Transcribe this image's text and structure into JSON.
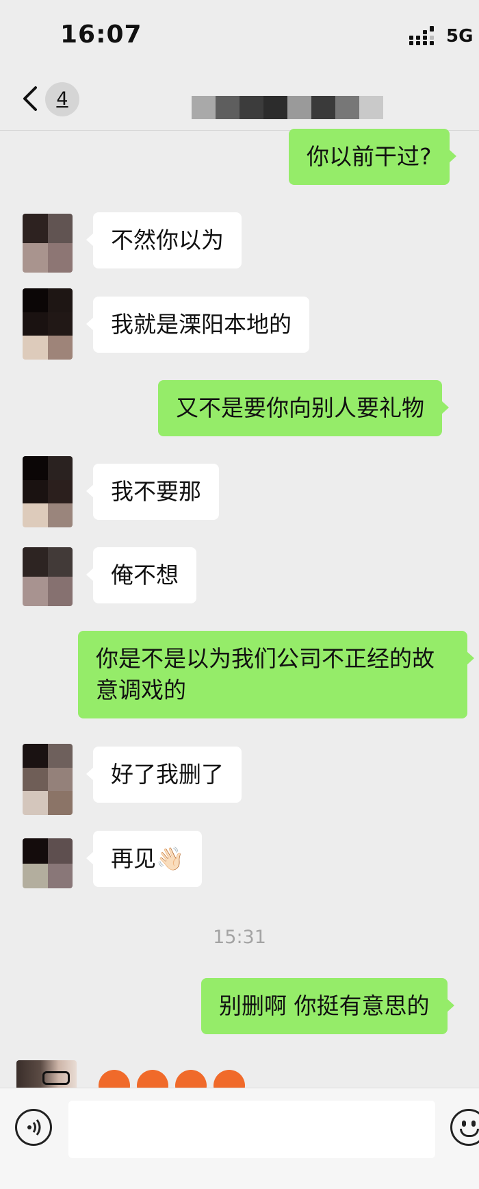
{
  "status": {
    "time": "16:07",
    "network": "5G"
  },
  "nav": {
    "unread_count": "4"
  },
  "messages": [
    {
      "side": "out",
      "text": "你以前干过?"
    },
    {
      "side": "in",
      "text": "不然你以为"
    },
    {
      "side": "in",
      "text": "我就是溧阳本地的"
    },
    {
      "side": "out",
      "text": "又不是要你向别人要礼物"
    },
    {
      "side": "in",
      "text": "我不要那"
    },
    {
      "side": "in",
      "text": "俺不想"
    },
    {
      "side": "out",
      "text": "你是不是以为我们公司不正经的故意调戏的"
    },
    {
      "side": "in",
      "text": "好了我删了"
    },
    {
      "side": "in",
      "text": "再见👋🏻"
    },
    {
      "side": "out",
      "text": "别删啊 你挺有意思的"
    }
  ],
  "timestamp": "15:31",
  "colors": {
    "background": "#ededed",
    "outgoing_bubble": "#95ec69",
    "incoming_bubble": "#ffffff"
  },
  "input_bar": {
    "left_icon": "voice-icon",
    "right_icon": "emoji-icon"
  }
}
